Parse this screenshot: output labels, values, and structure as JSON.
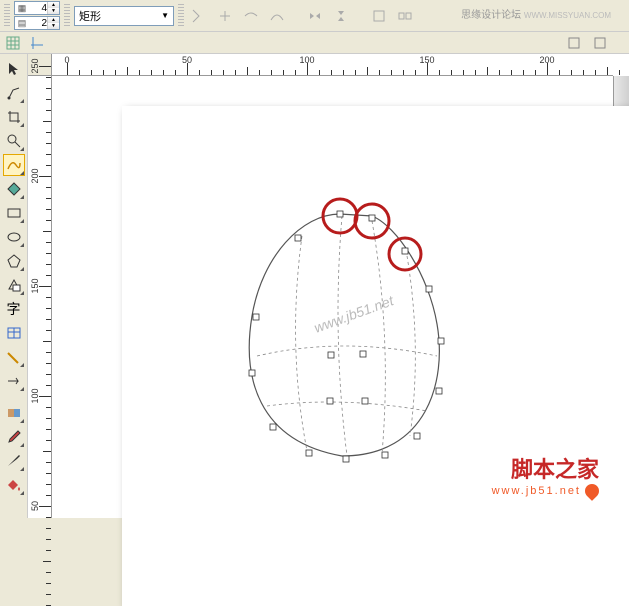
{
  "toolbar": {
    "columns": "4",
    "rows": "2",
    "shape_label": "矩形"
  },
  "ruler": {
    "h_labels": [
      "0",
      "50",
      "100",
      "150",
      "200"
    ],
    "v_labels": [
      "50",
      "100",
      "150",
      "200",
      "250"
    ]
  },
  "watermarks": {
    "top_text": "思缘设计论坛",
    "top_url": "WWW.MISSYUAN.COM",
    "center": "www.jb51.net"
  },
  "brand": {
    "cn": "脚本之家",
    "url": "www.jb51.net"
  }
}
